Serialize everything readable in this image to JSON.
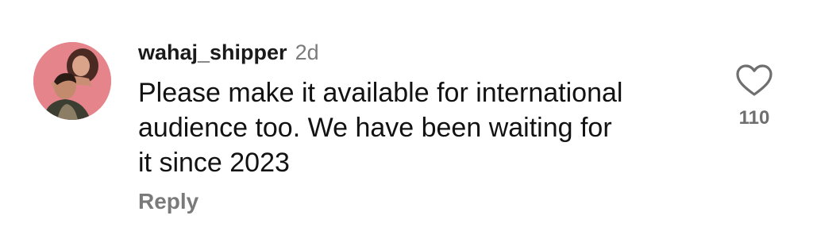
{
  "comment": {
    "username": "wahaj_shipper",
    "timestamp": "2d",
    "text": "Please make it available for international\naudience too. We have been waiting for\nit since 2023",
    "reply_label": "Reply",
    "like_count": "110",
    "like_icon": "heart-outline-icon",
    "avatar_background": "#e6848c"
  },
  "colors": {
    "username": "#1a1a1a",
    "secondary_text": "#7a7a7a",
    "body_text": "#121212",
    "icon_stroke": "#6f6f6f"
  }
}
